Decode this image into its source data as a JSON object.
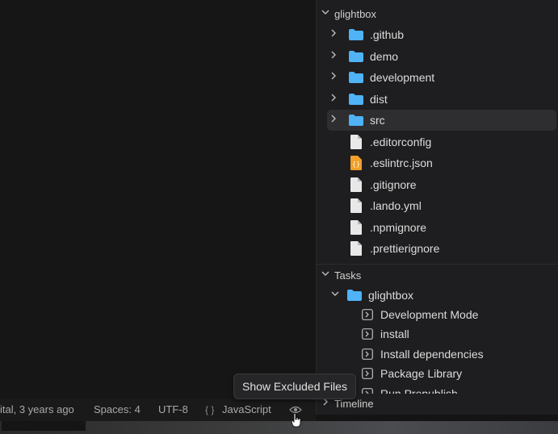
{
  "explorer": {
    "root_label": "glightbox",
    "items": [
      {
        "label": ".github",
        "kind": "folder"
      },
      {
        "label": "demo",
        "kind": "folder"
      },
      {
        "label": "development",
        "kind": "folder"
      },
      {
        "label": "dist",
        "kind": "folder"
      },
      {
        "label": "src",
        "kind": "folder",
        "selected": true
      },
      {
        "label": ".editorconfig",
        "kind": "file"
      },
      {
        "label": ".eslintrc.json",
        "kind": "json"
      },
      {
        "label": ".gitignore",
        "kind": "file"
      },
      {
        "label": ".lando.yml",
        "kind": "file"
      },
      {
        "label": ".npmignore",
        "kind": "file"
      },
      {
        "label": ".prettierignore",
        "kind": "file"
      }
    ]
  },
  "tasks": {
    "header": "Tasks",
    "group_label": "glightbox",
    "items": [
      {
        "label": "Development Mode"
      },
      {
        "label": "install"
      },
      {
        "label": "Install dependencies"
      },
      {
        "label": "Package Library"
      },
      {
        "label": "Run Prepublish"
      }
    ]
  },
  "timeline": {
    "header": "Timeline"
  },
  "statusbar": {
    "blame": "ital, 3 years ago",
    "spaces": "Spaces: 4",
    "encoding": "UTF-8",
    "language_icon": "{ }",
    "language": "JavaScript"
  },
  "tooltip": {
    "text": "Show Excluded Files"
  },
  "colors": {
    "folder": "#4fb3f6",
    "json_icon": "#f0a02a",
    "file_icon": "#e8e8e8",
    "selected_row": "#2e2e31"
  }
}
